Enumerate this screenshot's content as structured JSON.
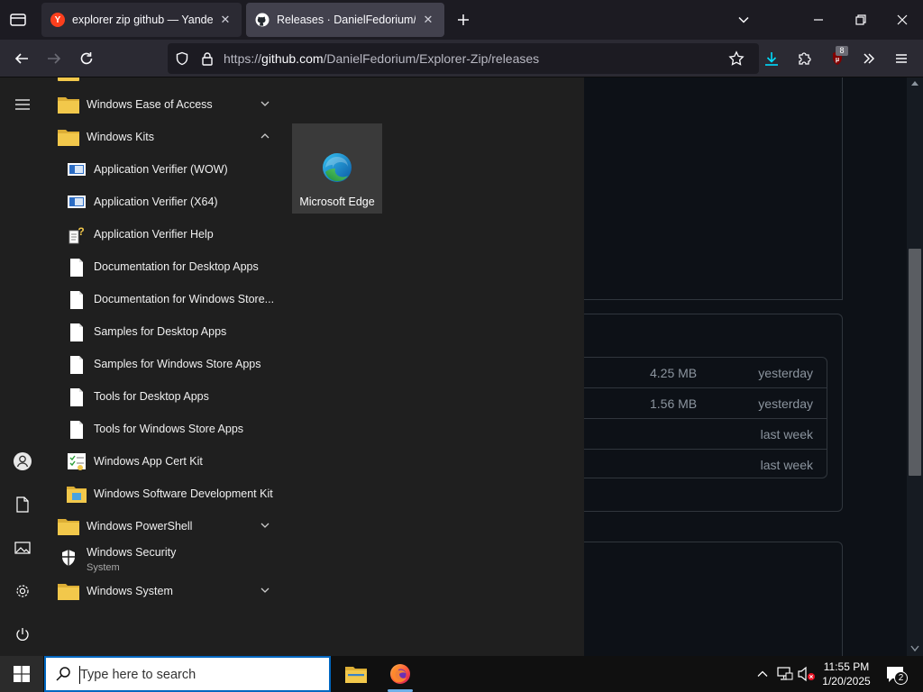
{
  "browser": {
    "tabs": [
      {
        "title": "explorer zip github — Yandex",
        "favicon_letter": "Y",
        "favicon_color": "#fc3f1d",
        "active": false
      },
      {
        "title": "Releases · DanielFedorium/Explorer-Zip",
        "active": true
      }
    ],
    "url": {
      "prefix": "https://",
      "host": "github.com",
      "path": "/DanielFedorium/Explorer-Zip/releases"
    },
    "extension_badge": "8"
  },
  "page": {
    "assets": [
      {
        "size": "4.25 MB",
        "date": "yesterday"
      },
      {
        "size": "1.56 MB",
        "date": "yesterday"
      },
      {
        "size": "",
        "date": "last week"
      },
      {
        "size": "",
        "date": "last week"
      }
    ]
  },
  "start_menu": {
    "items": [
      {
        "label": "Windows Ease of Access",
        "type": "folder",
        "expanded": false
      },
      {
        "label": "Windows Kits",
        "type": "folder",
        "expanded": true
      },
      {
        "label": "Application Verifier (WOW)",
        "type": "child",
        "icon": "app-verifier-icon"
      },
      {
        "label": "Application Verifier (X64)",
        "type": "child",
        "icon": "app-verifier-icon"
      },
      {
        "label": "Application Verifier Help",
        "type": "child",
        "icon": "help-document-icon"
      },
      {
        "label": "Documentation for Desktop Apps",
        "type": "child",
        "icon": "document-icon"
      },
      {
        "label": "Documentation for Windows Store...",
        "type": "child",
        "icon": "document-icon"
      },
      {
        "label": "Samples for Desktop Apps",
        "type": "child",
        "icon": "document-icon"
      },
      {
        "label": "Samples for Windows Store Apps",
        "type": "child",
        "icon": "document-icon"
      },
      {
        "label": "Tools for Desktop Apps",
        "type": "child",
        "icon": "document-icon"
      },
      {
        "label": "Tools for Windows Store Apps",
        "type": "child",
        "icon": "document-icon"
      },
      {
        "label": "Windows App Cert Kit",
        "type": "child",
        "icon": "cert-kit-icon"
      },
      {
        "label": "Windows Software Development Kit",
        "type": "child",
        "icon": "sdk-folder-icon"
      },
      {
        "label": "Windows PowerShell",
        "type": "folder",
        "expanded": false
      },
      {
        "label": "Windows Security",
        "sub": "System",
        "type": "app",
        "icon": "shield-icon"
      },
      {
        "label": "Windows System",
        "type": "folder",
        "expanded": false
      }
    ],
    "pinned_tile": {
      "label": "Microsoft Edge",
      "icon": "edge-icon"
    }
  },
  "taskbar": {
    "search_placeholder": "Type here to search",
    "time": "11:55 PM",
    "date": "1/20/2025",
    "notification_count": "2"
  },
  "colors": {
    "accent": "#0067c0",
    "folder": "#f2c84b",
    "download_blue": "#00ddff"
  }
}
